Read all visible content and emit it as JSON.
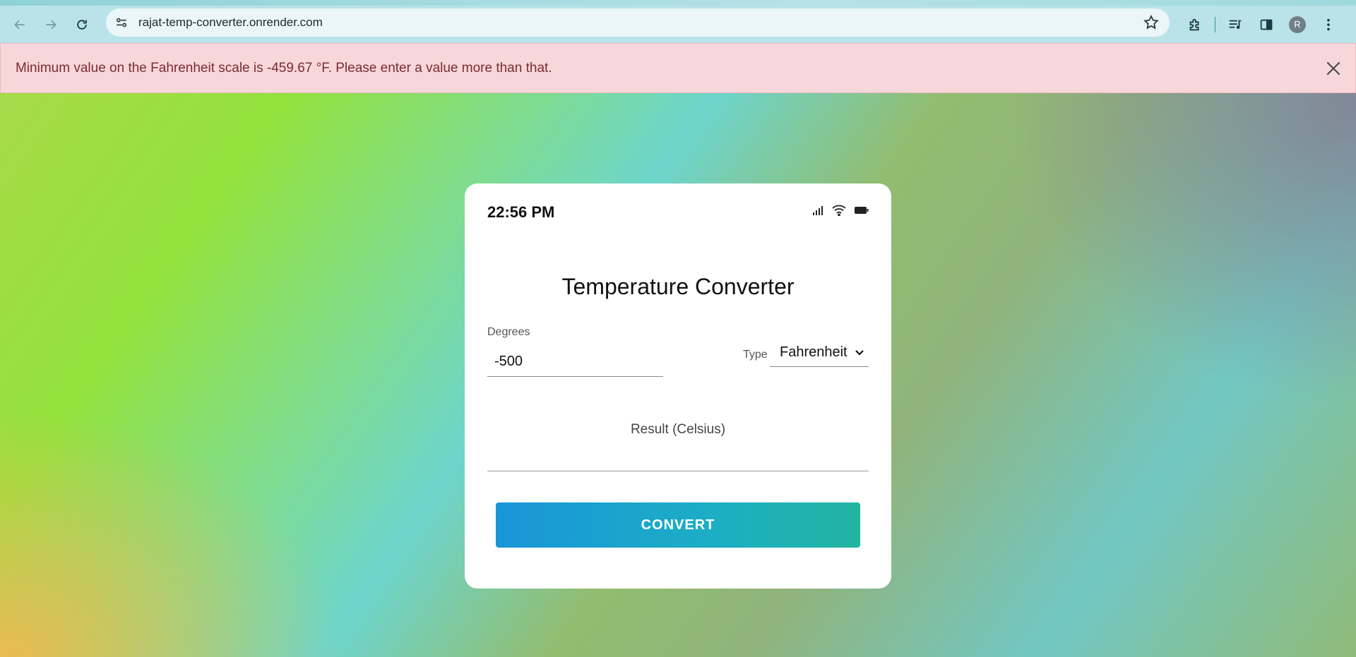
{
  "browser": {
    "url": "rajat-temp-converter.onrender.com",
    "avatar_letter": "R",
    "icons": [
      "back-arrow-icon",
      "forward-arrow-icon",
      "reload-icon",
      "site-info-icon",
      "bookmark-star-icon",
      "extensions-icon",
      "media-controls-icon",
      "side-panel-icon",
      "kebab-menu-icon"
    ]
  },
  "alert": {
    "message": "Minimum value on the Fahrenheit scale is -459.67 °F. Please enter a value more than that.",
    "background": "#f8d7da",
    "text_color": "#7a2b33"
  },
  "card": {
    "status_time": "22:56 PM",
    "title": "Temperature Converter",
    "degrees_label": "Degrees",
    "degrees_value": "-500",
    "type_label": "Type",
    "type_selected": "Fahrenheit",
    "result_label": "Result (Celsius)",
    "convert_label": "CONVERT",
    "button_colors": [
      "#1996d8",
      "#22b5a0"
    ]
  }
}
